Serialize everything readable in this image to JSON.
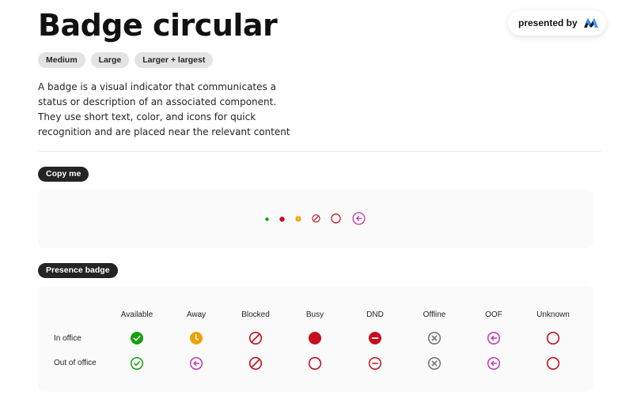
{
  "header": {
    "title": "Badge circular",
    "presented_by": "presented by",
    "tags": [
      "Medium",
      "Large",
      "Larger + largest"
    ]
  },
  "description": "A badge is a visual indicator that communicates a status or description of an associated component. They use short text, color, and icons for quick recognition and are placed near the relevant content",
  "sections": {
    "copy_label": "Copy me",
    "presence_label": "Presence badge"
  },
  "copy_row": {
    "badges": [
      "available-dot-icon",
      "busy-dot-icon",
      "away-dot-icon",
      "blocked-icon",
      "offline-icon",
      "oof-icon"
    ]
  },
  "presence_table": {
    "columns": [
      "Available",
      "Away",
      "Blocked",
      "Busy",
      "DND",
      "Offline",
      "OOF",
      "Unknown"
    ],
    "rows": [
      {
        "label": "In office",
        "icons": [
          "available-check-filled-icon",
          "away-clock-filled-icon",
          "blocked-icon",
          "busy-filled-icon",
          "dnd-filled-icon",
          "offline-x-icon",
          "oof-arrow-icon",
          "unknown-ring-icon"
        ]
      },
      {
        "label": "Out of office",
        "icons": [
          "available-check-outline-icon",
          "oof-arrow-icon",
          "blocked-icon",
          "unknown-ring-icon",
          "dnd-outline-icon",
          "offline-x-icon",
          "oof-arrow-icon",
          "unknown-ring-icon"
        ]
      }
    ]
  },
  "colors": {
    "available": "#13a10e",
    "away": "#eaa300",
    "busy": "#c50f1f",
    "offline": "#707070",
    "oof": "#c239b3",
    "pill_bg": "#242424",
    "tag_bg": "#e3e3e3",
    "card_bg": "#fafafa"
  }
}
